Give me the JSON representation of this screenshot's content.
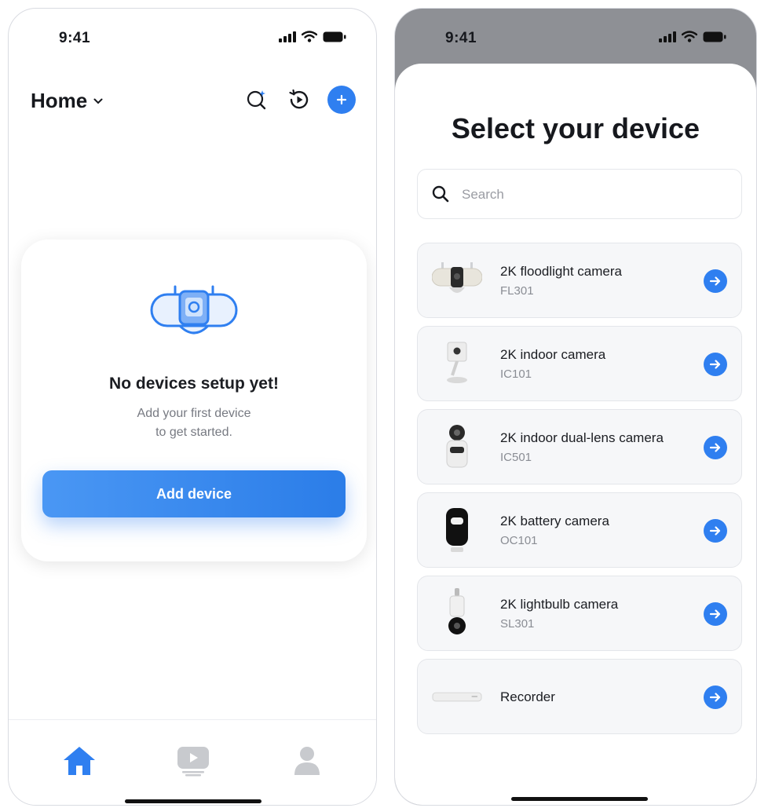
{
  "left": {
    "status": {
      "time": "9:41"
    },
    "header": {
      "title": "Home"
    },
    "empty_state": {
      "title": "No devices setup yet!",
      "subtitle_line1": "Add your first device",
      "subtitle_line2": "to get started.",
      "button_label": "Add device"
    },
    "tabs": [
      {
        "icon": "home-icon",
        "active": true
      },
      {
        "icon": "video-icon",
        "active": false
      },
      {
        "icon": "profile-icon",
        "active": false
      }
    ]
  },
  "right": {
    "status": {
      "time": "9:41"
    },
    "title": "Select your device",
    "search": {
      "placeholder": "Search",
      "value": ""
    },
    "devices": [
      {
        "name": "2K floodlight camera",
        "model": "FL301",
        "icon": "floodlight-camera-image"
      },
      {
        "name": "2K indoor camera",
        "model": "IC101",
        "icon": "indoor-camera-image"
      },
      {
        "name": "2K indoor dual-lens camera",
        "model": "IC501",
        "icon": "dual-lens-camera-image"
      },
      {
        "name": "2K battery camera",
        "model": "OC101",
        "icon": "battery-camera-image"
      },
      {
        "name": "2K lightbulb camera",
        "model": "SL301",
        "icon": "lightbulb-camera-image"
      },
      {
        "name": "Recorder",
        "model": "",
        "icon": "recorder-image"
      }
    ]
  },
  "colors": {
    "accent": "#2f7ff0",
    "text": "#16181d",
    "muted": "#8a8d94",
    "card": "#f6f7f9",
    "tab_inactive": "#c8cace"
  }
}
